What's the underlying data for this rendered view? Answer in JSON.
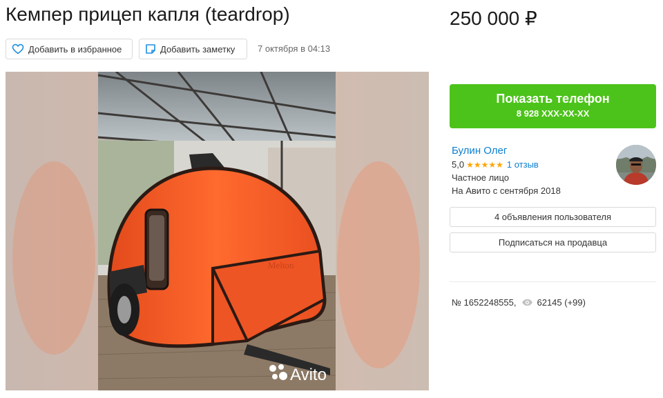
{
  "listing": {
    "title": "Кемпер прицеп капля (teardrop)",
    "price": "250 000 ₽",
    "date": "7 октября в 04:13",
    "watermark": "Avito"
  },
  "actions": {
    "favorite_label": "Добавить в избранное",
    "note_label": "Добавить заметку"
  },
  "contact": {
    "phone_button_label": "Показать телефон",
    "phone_masked": "8 928 XXX-XX-XX"
  },
  "seller": {
    "name": "Булин Олег",
    "rating": "5,0",
    "stars": "★★★★★",
    "reviews": "1 отзыв",
    "type": "Частное лицо",
    "since": "На Авито с сентября 2018",
    "ads_button": "4 объявления пользователя",
    "subscribe_button": "Подписаться на продавца"
  },
  "meta": {
    "ad_number": "№ 1652248555,",
    "views": "62145 (+99)"
  },
  "colors": {
    "accent_green": "#4cc31a",
    "link_blue": "#0a7fd1",
    "star_orange": "#ffa500",
    "trailer_orange": "#f4612a"
  },
  "icons": {
    "favorite": "heart-icon",
    "note": "note-icon",
    "views": "eye-icon",
    "watermark": "avito-logo-icon"
  }
}
